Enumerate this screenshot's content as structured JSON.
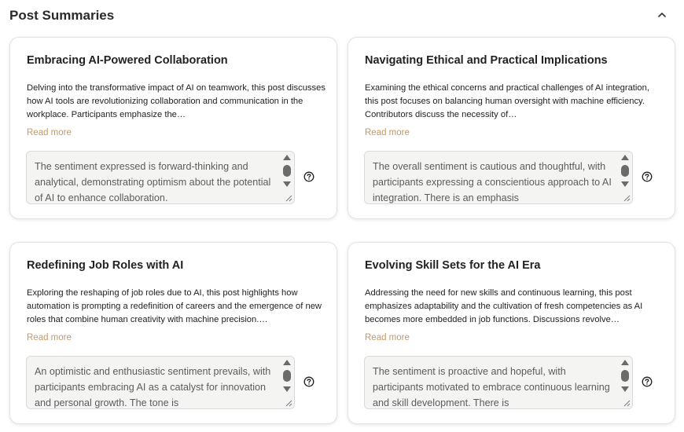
{
  "header": {
    "title": "Post Summaries"
  },
  "icons": {
    "collapse": "chevron-up-icon",
    "help": "question-circle-icon"
  },
  "colors": {
    "read_more": "#c19a66",
    "sentiment_bg": "#f4f4f2"
  },
  "cards": [
    {
      "title": "Embracing AI-Powered Collaboration",
      "description": "Delving into the transformative impact of AI on teamwork, this post discusses how AI tools are revolutionizing collaboration and communication in the workplace. Participants emphasize the…",
      "read_more": "Read more",
      "sentiment": "The sentiment expressed is forward-thinking and analytical, demonstrating optimism about the potential of AI to enhance collaboration."
    },
    {
      "title": "Navigating Ethical and Practical Implications",
      "description": "Examining the ethical concerns and practical challenges of AI integration, this post focuses on balancing human oversight with machine efficiency. Contributors discuss the necessity of…",
      "read_more": "Read more",
      "sentiment": "The overall sentiment is cautious and thoughtful, with participants expressing a conscientious approach to AI integration. There is an emphasis"
    },
    {
      "title": "Redefining Job Roles with AI",
      "description": "Exploring the reshaping of job roles due to AI, this post highlights how automation is prompting a redefinition of careers and the emergence of new roles that combine human creativity with machine precision.…",
      "read_more": "Read more",
      "sentiment": "An optimistic and enthusiastic sentiment prevails, with participants embracing AI as a catalyst for innovation and personal growth. The tone is"
    },
    {
      "title": "Evolving Skill Sets for the AI Era",
      "description": "Addressing the need for new skills and continuous learning, this post emphasizes adaptability and the cultivation of fresh competencies as AI becomes more embedded in job functions. Discussions revolve…",
      "read_more": "Read more",
      "sentiment": "The sentiment is proactive and hopeful, with participants motivated to embrace continuous learning and skill development. There is"
    }
  ]
}
